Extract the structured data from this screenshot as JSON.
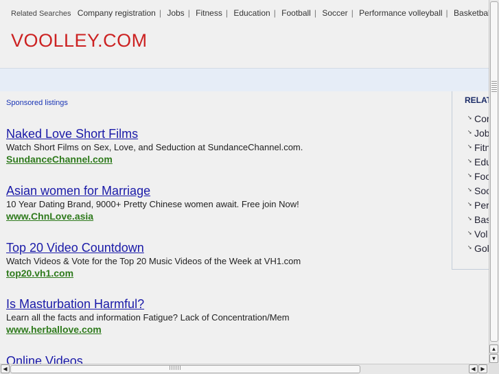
{
  "top_bar": {
    "label": "Related Searches",
    "links": [
      "Company registration",
      "Jobs",
      "Fitness",
      "Education",
      "Football",
      "Soccer",
      "Performance volleyball",
      "Basketball",
      ""
    ]
  },
  "logo": "VOOLLEY.COM",
  "sponsored_label": "Sponsored listings",
  "listings": [
    {
      "title": "Naked Love Short Films",
      "desc": "Watch Short Films on Sex, Love, and Seduction at SundanceChannel.com.",
      "url": "SundanceChannel.com"
    },
    {
      "title": "Asian women for Marriage",
      "desc": "10 Year Dating Brand, 9000+ Pretty Chinese women await. Free join Now!",
      "url": "www.ChnLove.asia"
    },
    {
      "title": "Top 20 Video Countdown",
      "desc": "Watch Videos & Vote for the Top 20 Music Videos of the Week at VH1.com",
      "url": "top20.vh1.com"
    },
    {
      "title": "Is Masturbation Harmful?",
      "desc": "Learn all the facts and information Fatigue? Lack of Concentration/Mem",
      "url": "www.herballove.com"
    },
    {
      "title": "Online Videos",
      "desc": "",
      "url": ""
    }
  ],
  "right_panel": {
    "heading": "RELAT",
    "items": [
      "Cor",
      "Job",
      "Fitn",
      "Edu",
      "Foo",
      "Soc",
      "Per",
      "Bas",
      "Vol",
      "Gol"
    ]
  },
  "scrollbar": {
    "up_arrow": "▲",
    "down_arrow": "▼",
    "left_arrow": "◀",
    "right_arrow": "▶"
  }
}
